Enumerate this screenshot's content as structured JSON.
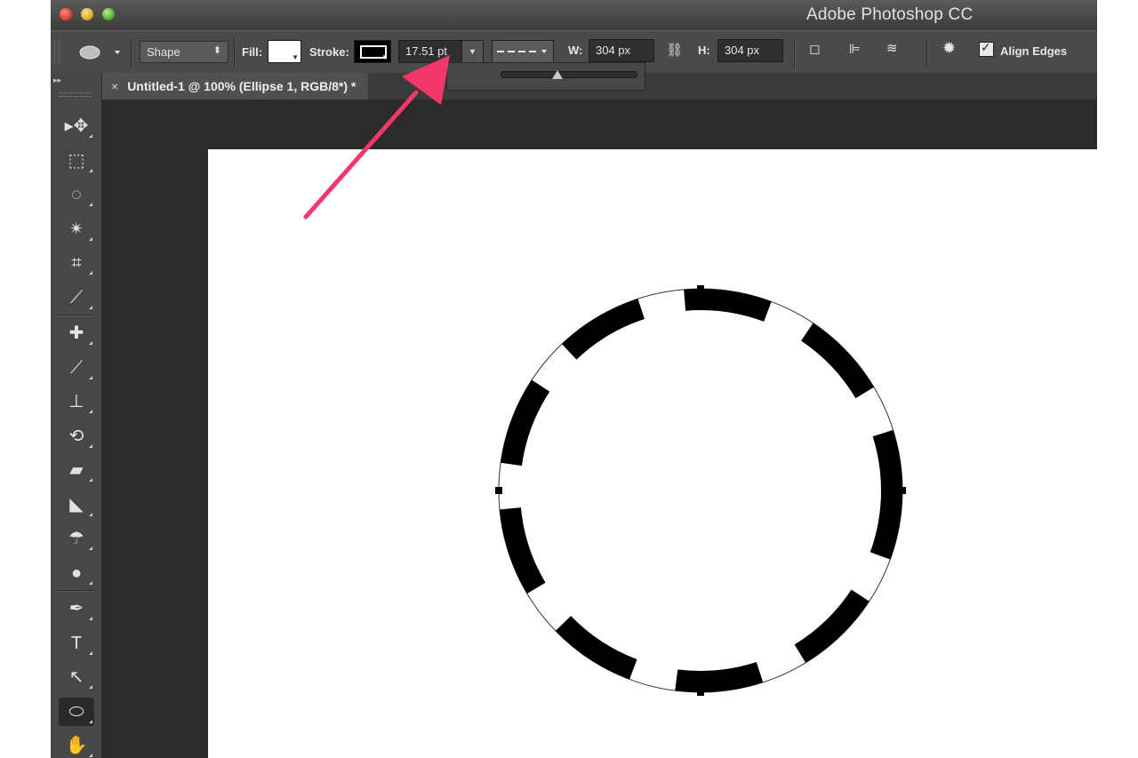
{
  "window": {
    "app_title": "Adobe Photoshop CC"
  },
  "options_bar": {
    "tool_mode": "Shape",
    "fill_label": "Fill:",
    "stroke_label": "Stroke:",
    "stroke_width": "17.51 pt",
    "width_label": "W:",
    "width_value": "304 px",
    "height_label": "H:",
    "height_value": "304 px",
    "align_edges_label": "Align Edges",
    "align_edges_checked": true,
    "fill_color": "#ffffff",
    "stroke_color": "#000000",
    "stroke_width_slider_level": 0.43
  },
  "document": {
    "tab_title": "Untitled-1 @ 100% (Ellipse 1, RGB/8*) *",
    "tab_close_glyph": "×",
    "canvas_color": "#ffffff"
  },
  "annotation": {
    "arrow_color": "#f2386b"
  },
  "ellipse": {
    "stroke_style": "dashed",
    "stroke_color": "#000000"
  },
  "tools": [
    {
      "name": "move-tool",
      "glyph": "▸✥"
    },
    {
      "name": "rectangular-marquee-tool",
      "glyph": "⬚"
    },
    {
      "name": "lasso-tool",
      "glyph": "◌"
    },
    {
      "name": "magic-wand-tool",
      "glyph": "✴"
    },
    {
      "name": "crop-tool",
      "glyph": "⌗"
    },
    {
      "name": "eyedropper-tool",
      "glyph": "⟋"
    },
    {
      "name": "spot-healing-brush-tool",
      "glyph": "✚"
    },
    {
      "name": "brush-tool",
      "glyph": "⟋"
    },
    {
      "name": "clone-stamp-tool",
      "glyph": "⊥"
    },
    {
      "name": "history-brush-tool",
      "glyph": "⟲"
    },
    {
      "name": "eraser-tool",
      "glyph": "▰"
    },
    {
      "name": "paint-bucket-tool",
      "glyph": "◣"
    },
    {
      "name": "blur-tool",
      "glyph": "☂"
    },
    {
      "name": "dodge-tool",
      "glyph": "●"
    },
    {
      "name": "pen-tool",
      "glyph": "✒"
    },
    {
      "name": "type-tool",
      "glyph": "T"
    },
    {
      "name": "path-selection-tool",
      "glyph": "↖"
    },
    {
      "name": "ellipse-tool",
      "glyph": "⬭"
    },
    {
      "name": "hand-tool",
      "glyph": "✋"
    }
  ]
}
